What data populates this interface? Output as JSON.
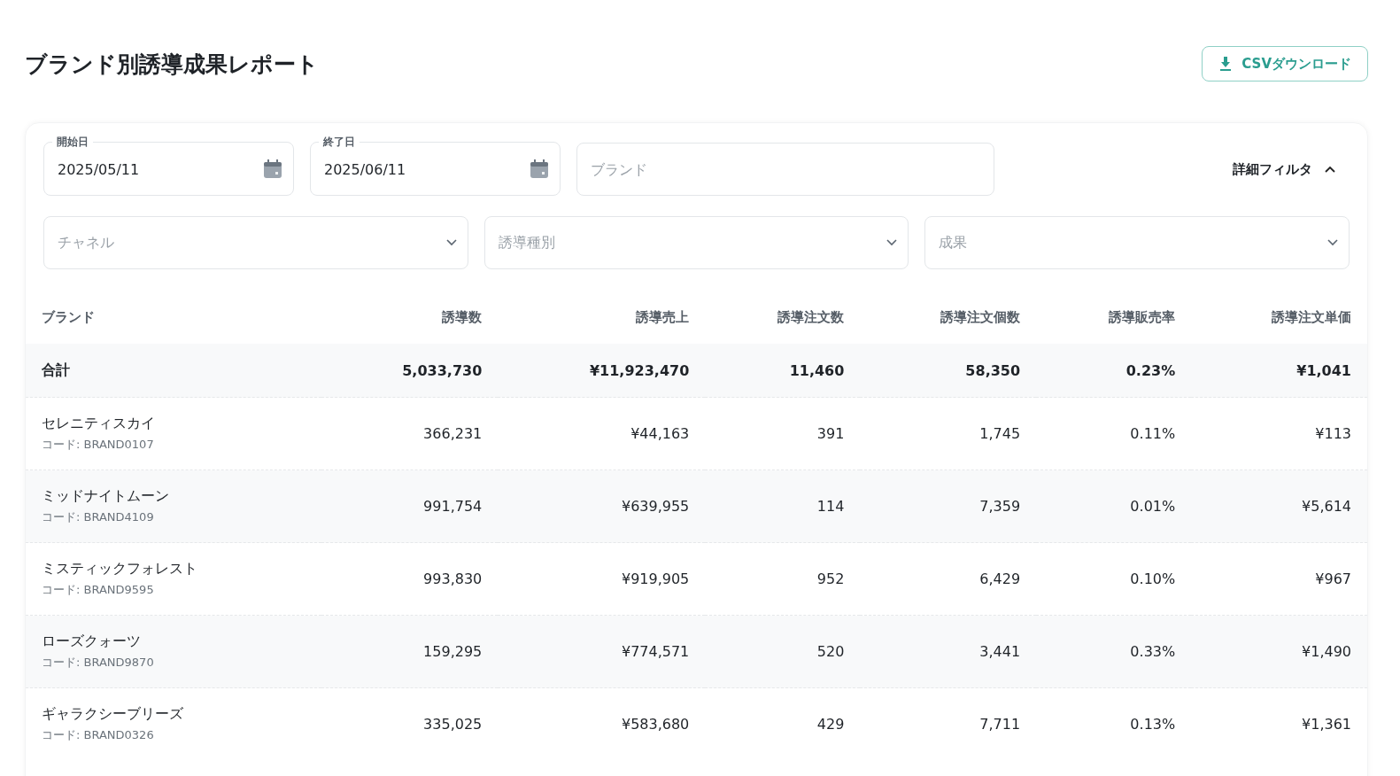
{
  "title": "ブランド別誘導成果レポート",
  "download_button": {
    "label": "CSVダウンロード"
  },
  "filters": {
    "start_date": {
      "label": "開始日",
      "value": "2025/05/11"
    },
    "end_date": {
      "label": "終了日",
      "value": "2025/06/11"
    },
    "brand": {
      "placeholder": "ブランド"
    },
    "detail_toggle": {
      "label": "詳細フィルタ",
      "expanded": true
    },
    "selects": [
      {
        "placeholder": "チャネル"
      },
      {
        "placeholder": "誘導種別"
      },
      {
        "placeholder": "成果"
      }
    ]
  },
  "table": {
    "columns": [
      "ブランド",
      "誘導数",
      "誘導売上",
      "誘導注文数",
      "誘導注文個数",
      "誘導販売率",
      "誘導注文単価"
    ],
    "total": {
      "label": "合計",
      "values": [
        "5,033,730",
        "¥11,923,470",
        "11,460",
        "58,350",
        "0.23%",
        "¥1,041"
      ]
    },
    "rows": [
      {
        "name": "セレニティスカイ",
        "code": "コード: BRAND0107",
        "values": [
          "366,231",
          "¥44,163",
          "391",
          "1,745",
          "0.11%",
          "¥113"
        ]
      },
      {
        "name": "ミッドナイトムーン",
        "code": "コード: BRAND4109",
        "values": [
          "991,754",
          "¥639,955",
          "114",
          "7,359",
          "0.01%",
          "¥5,614"
        ]
      },
      {
        "name": "ミスティックフォレスト",
        "code": "コード: BRAND9595",
        "values": [
          "993,830",
          "¥919,905",
          "952",
          "6,429",
          "0.10%",
          "¥967"
        ]
      },
      {
        "name": "ローズクォーツ",
        "code": "コード: BRAND9870",
        "values": [
          "159,295",
          "¥774,571",
          "520",
          "3,441",
          "0.33%",
          "¥1,490"
        ]
      },
      {
        "name": "ギャラクシーブリーズ",
        "code": "コード: BRAND0326",
        "values": [
          "335,025",
          "¥583,680",
          "429",
          "7,711",
          "0.13%",
          "¥1,361"
        ]
      }
    ]
  }
}
